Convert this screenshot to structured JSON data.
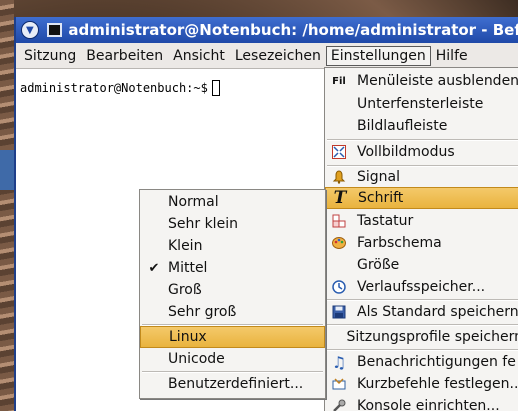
{
  "window": {
    "title": "administrator@Notenbuch: /home/administrator - Befe"
  },
  "menubar": [
    {
      "label": "Sitzung"
    },
    {
      "label": "Bearbeiten"
    },
    {
      "label": "Ansicht"
    },
    {
      "label": "Lesezeichen"
    },
    {
      "label": "Einstellungen",
      "active": true
    },
    {
      "label": "Hilfe"
    }
  ],
  "terminal": {
    "prompt": "administrator@Notenbuch:~$"
  },
  "einstellungen_menu": [
    {
      "label": "Menüleiste ausblenden",
      "icon": "menubar-icon",
      "glyph": "▤"
    },
    {
      "label": "Unterfensterleiste",
      "icon": "",
      "glyph": ""
    },
    {
      "label": "Bildlaufleiste",
      "icon": "",
      "glyph": ""
    },
    {
      "label": "Vollbildmodus",
      "icon": "fullscreen-icon",
      "glyph": "⛶"
    },
    {
      "label": "Signal",
      "icon": "bell-icon",
      "glyph": "🔔"
    },
    {
      "label": "Schrift",
      "icon": "font-icon",
      "glyph": "T",
      "highlighted": true
    },
    {
      "label": "Tastatur",
      "icon": "keyboard-icon",
      "glyph": "⌨"
    },
    {
      "label": "Farbschema",
      "icon": "palette-icon",
      "glyph": "🎨"
    },
    {
      "label": "Größe",
      "icon": "",
      "glyph": ""
    },
    {
      "label": "Verlaufsspeicher...",
      "icon": "history-icon",
      "glyph": "◴"
    },
    {
      "label": "Als Standard speichern",
      "icon": "save-icon",
      "glyph": "💾"
    },
    {
      "label": "Sitzungsprofile speichern",
      "icon": "",
      "glyph": ""
    },
    {
      "label": "Benachrichtigungen fe",
      "icon": "music-note-icon",
      "glyph": "♫"
    },
    {
      "label": "Kurzbefehle festlegen...",
      "icon": "shortcuts-icon",
      "glyph": "⌘"
    },
    {
      "label": "Konsole einrichten...",
      "icon": "wrench-icon",
      "glyph": "🔧"
    }
  ],
  "schrift_menu": [
    {
      "label": "Normal",
      "checked": false
    },
    {
      "label": "Sehr klein",
      "checked": false
    },
    {
      "label": "Klein",
      "checked": false
    },
    {
      "label": "Mittel",
      "checked": true
    },
    {
      "label": "Groß",
      "checked": false
    },
    {
      "label": "Sehr groß",
      "checked": false
    },
    {
      "label": "Linux",
      "checked": false,
      "highlighted": true
    },
    {
      "label": "Unicode",
      "checked": false
    },
    {
      "label": "Benutzerdefiniert...",
      "checked": false
    }
  ],
  "colors": {
    "titlebar": "#2b58c0",
    "highlight": "#efbf55",
    "menu_bg": "#f5f4f2"
  }
}
